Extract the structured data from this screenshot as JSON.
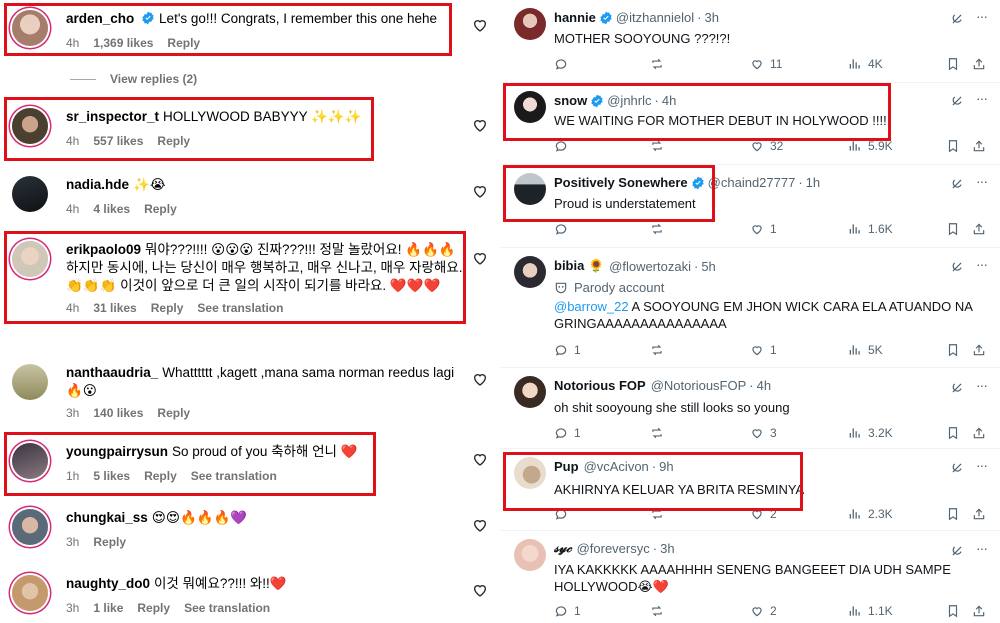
{
  "instagram": {
    "comments": [
      {
        "user": "arden_cho",
        "verified": true,
        "text": "Let's go!!! Congrats, I remember this one hehe",
        "time": "4h",
        "likes": "1,369 likes",
        "reply": "Reply",
        "translate": ""
      },
      {
        "user": "sr_inspector_t",
        "verified": false,
        "text": "HOLLYWOOD BABYYY ✨✨✨",
        "time": "4h",
        "likes": "557 likes",
        "reply": "Reply",
        "translate": ""
      },
      {
        "user": "nadia.hde",
        "verified": false,
        "text": "✨😭",
        "time": "4h",
        "likes": "4 likes",
        "reply": "Reply",
        "translate": ""
      },
      {
        "user": "erikpaolo09",
        "verified": false,
        "text": "뭐야???!!!! 😮😮😮 진짜???!!! 정말 놀랐어요! 🔥🔥🔥 하지만 동시에, 나는 당신이 매우 행복하고, 매우 신나고, 매우 자랑해요. 👏👏👏 이것이 앞으로 더 큰 일의 시작이 되기를 바라요. ❤️❤️❤️",
        "time": "4h",
        "likes": "31 likes",
        "reply": "Reply",
        "translate": "See translation"
      },
      {
        "user": "nanthaaudria_",
        "verified": false,
        "text": "Whatttttt ,kagett ,mana sama norman reedus lagi 🔥😮",
        "time": "3h",
        "likes": "140 likes",
        "reply": "Reply",
        "translate": ""
      },
      {
        "user": "youngpairrysun",
        "verified": false,
        "text": "So proud of you 축하해 언니 ❤️",
        "time": "1h",
        "likes": "5 likes",
        "reply": "Reply",
        "translate": "See translation"
      },
      {
        "user": "chungkai_ss",
        "verified": false,
        "text": "😍😍🔥🔥🔥💜",
        "time": "3h",
        "likes": "",
        "reply": "Reply",
        "translate": ""
      },
      {
        "user": "naughty_do0",
        "verified": false,
        "text": "이것 뭐예요??!!! 와!!❤️",
        "time": "3h",
        "likes": "1 like",
        "reply": "Reply",
        "translate": "See translation"
      }
    ],
    "view_replies": "View replies (2)"
  },
  "x": {
    "posts": [
      {
        "name": "hannie",
        "verified": true,
        "handle": "@itzhannielol",
        "time": "3h",
        "text": "MOTHER SOOYOUNG ???!?!",
        "parody": "",
        "mention": "",
        "replies": "",
        "reposts": "",
        "likes": "11",
        "views": "4K"
      },
      {
        "name": "snow",
        "verified": true,
        "handle": "@jnhrlc",
        "time": "4h",
        "text": "WE WAITING FOR MOTHER DEBUT IN HOLYWOOD !!!!",
        "parody": "",
        "mention": "",
        "replies": "",
        "reposts": "",
        "likes": "32",
        "views": "5.9K"
      },
      {
        "name": "Positively Sonewhere",
        "verified": true,
        "handle": "@chaind27777",
        "time": "1h",
        "text": "Proud is understatement",
        "parody": "",
        "mention": "",
        "replies": "",
        "reposts": "",
        "likes": "1",
        "views": "1.6K"
      },
      {
        "name": "bibia 🌻",
        "verified": false,
        "handle": "@flowertozaki",
        "time": "5h",
        "text": "A SOOYOUNG EM JHON WICK CARA ELA ATUANDO NA GRINGAAAAAAAAAAAAAAA",
        "parody": "Parody account",
        "mention": "@barrow_22",
        "replies": "1",
        "reposts": "",
        "likes": "1",
        "views": "5K"
      },
      {
        "name": "Notorious FOP",
        "verified": false,
        "handle": "@NotoriousFOP",
        "time": "4h",
        "text": "oh shit sooyoung she still looks so young",
        "parody": "",
        "mention": "",
        "replies": "1",
        "reposts": "",
        "likes": "3",
        "views": "3.2K"
      },
      {
        "name": "Pup",
        "verified": false,
        "handle": "@vcAcivon",
        "time": "9h",
        "text": "AKHIRNYA KELUAR YA BRITA RESMINYA",
        "parody": "",
        "mention": "",
        "replies": "",
        "reposts": "",
        "likes": "2",
        "views": "2.3K"
      },
      {
        "name": "𝓈𝓎𝒸",
        "verified": false,
        "handle": "@foreversyc",
        "time": "3h",
        "text": "IYA KAKKKKK AAAAHHHH SENENG BANGEEET DIA UDH SAMPE HOLLYWOOD😭❤️",
        "parody": "",
        "mention": "",
        "replies": "1",
        "reposts": "",
        "likes": "2",
        "views": "1.1K"
      }
    ]
  },
  "colors": {
    "highlight": "#e0101a",
    "verified": "#1d9bf0",
    "ig_heart": "#262626",
    "muted": "#737373",
    "x_muted": "#536471"
  }
}
